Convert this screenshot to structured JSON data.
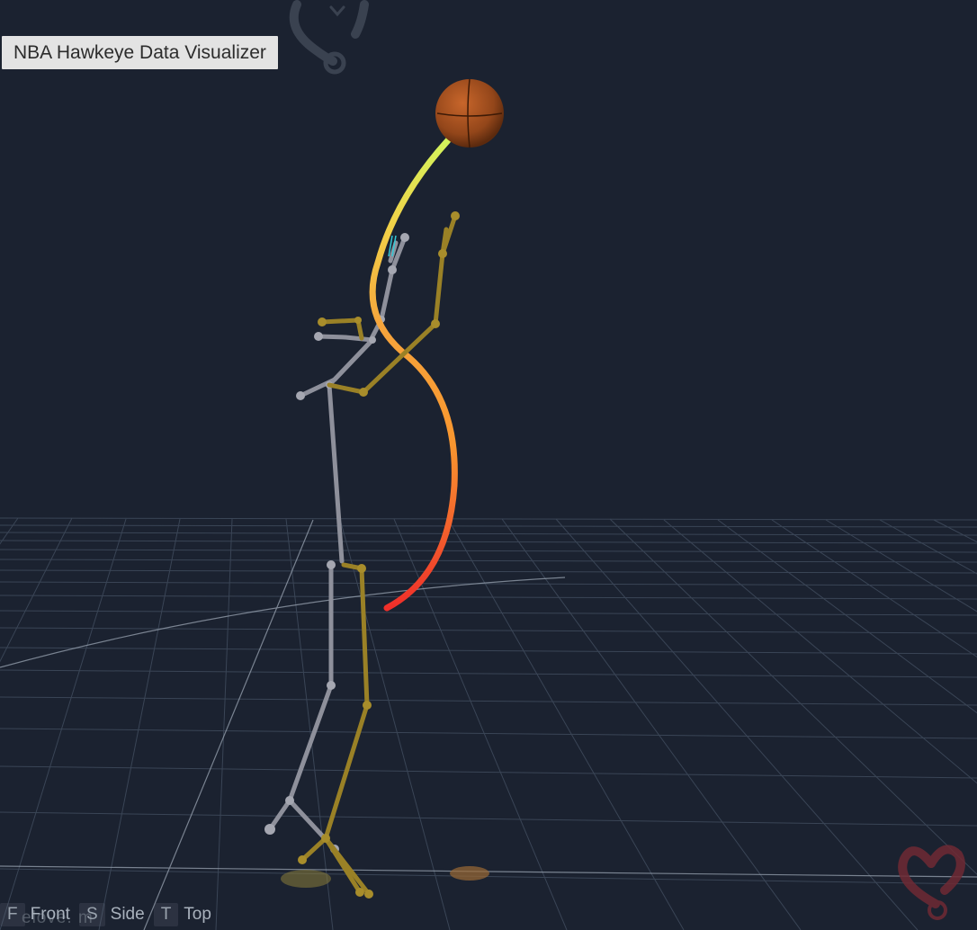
{
  "app": {
    "title": "NBA Hawkeye Data Visualizer"
  },
  "view_controls": [
    {
      "key": "F",
      "label": "Front"
    },
    {
      "key": "S",
      "label": "Side"
    },
    {
      "key": "T",
      "label": "Top"
    }
  ],
  "overlay_text": "elove. m",
  "icons": {
    "top_logo": "heart-logo-icon",
    "corner_logo": "heart-logo-icon"
  },
  "colors": {
    "background": "#1b2230",
    "grid_line": "#3a4556",
    "bone_gray": "#8d8f99",
    "bone_gold": "#9b8226",
    "ball": "#a5501c",
    "trail_start": "#ef2f2a",
    "trail_mid": "#f7a63a",
    "trail_end": "#d6f25a",
    "logo": "#7a2f3a"
  }
}
